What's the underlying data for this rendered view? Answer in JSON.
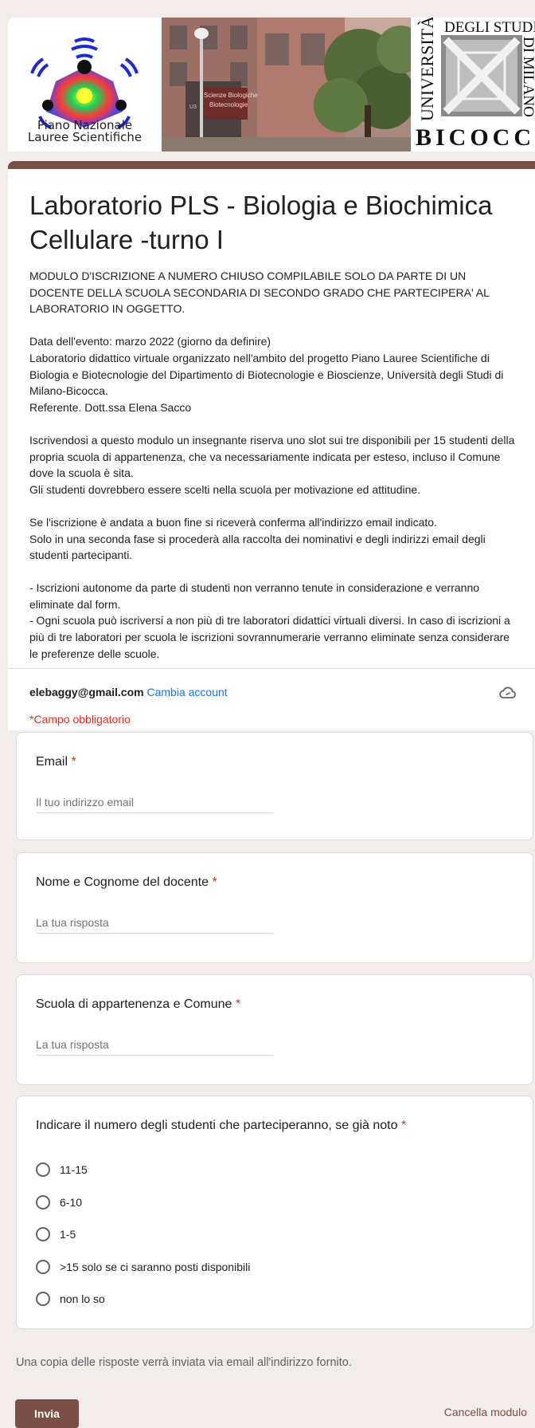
{
  "banner": {
    "pls_caption_line1": "Piano Nazionale",
    "pls_caption_line2": "Lauree Scientifiche",
    "photo_sign_1": "Scienze Biologiche",
    "photo_sign_2": "Biotecnologie",
    "photo_sign_3": "U3",
    "unimib_universita": "UNIVERSITÀ",
    "unimib_degli_studi": "DEGLI STUDI",
    "unimib_di_milano": "DI MILANO",
    "unimib_bicocca": "BICOCCA"
  },
  "header": {
    "title": "Laboratorio PLS - Biologia e Biochimica Cellulare -turno I",
    "description": [
      "MODULO D'ISCRIZIONE A NUMERO CHIUSO COMPILABILE SOLO DA PARTE DI UN DOCENTE DELLA SCUOLA SECONDARIA DI SECONDO GRADO CHE PARTECIPERA' AL LABORATORIO IN OGGETTO.",
      "",
      "Data dell'evento: marzo 2022 (giorno da definire)",
      "Laboratorio didattico virtuale organizzato nell'ambito del progetto Piano Lauree Scientifiche di Biologia e Biotecnologie del Dipartimento di Biotecnologie e Bioscienze, Università degli Studi di Milano-Bicocca.",
      "Referente. Dott.ssa Elena Sacco",
      "",
      "Iscrivendosi a questo modulo un insegnante riserva uno slot sui tre disponibili per 15 studenti della propria scuola di appartenenza, che va necessariamente indicata per esteso, incluso il Comune dove la scuola è sita.",
      "Gli studenti dovrebbero essere scelti nella scuola per motivazione ed attitudine.",
      "",
      "Se l'iscrizione è andata a buon fine si riceverà conferma all'indirizzo email indicato.",
      "Solo in una seconda fase si procederà alla raccolta dei nominativi e degli indirizzi email degli studenti partecipanti.",
      "",
      "- Iscrizioni autonome da parte di studenti non verranno tenute in considerazione e verranno eliminate dal form.",
      "- Ogni scuola può iscriversi a non più di tre laboratori didattici virtuali diversi. In caso di iscrizioni a più di tre laboratori per scuola le iscrizioni sovrannumerarie verranno eliminate senza considerare le preferenze delle scuole."
    ],
    "account_email": "elebaggy@gmail.com",
    "switch_account": "Cambia account",
    "required_note": "*Campo obbligatorio",
    "icon": "cloud-icon"
  },
  "questions": {
    "email": {
      "label": "Email",
      "placeholder": "Il tuo indirizzo email"
    },
    "name": {
      "label": "Nome e Cognome del docente",
      "placeholder": "La tua risposta"
    },
    "school": {
      "label": "Scuola di appartenenza e Comune",
      "placeholder": "La tua risposta"
    },
    "students": {
      "label": "Indicare il numero degli studenti che parteciperanno, se già noto",
      "options": [
        "11-15",
        "6-10",
        "1-5",
        ">15 solo se ci saranno posti disponibili",
        "non lo so"
      ]
    },
    "required_mark": "*"
  },
  "footer": {
    "copy_note": "Una copia delle risposte verrà inviata via email all'indirizzo fornito.",
    "submit_label": "Invia",
    "clear_label": "Cancella modulo"
  },
  "colors": {
    "accent": "#7b4e48",
    "link": "#1a73e8",
    "required": "#d93025",
    "background": "#f2eceb"
  }
}
